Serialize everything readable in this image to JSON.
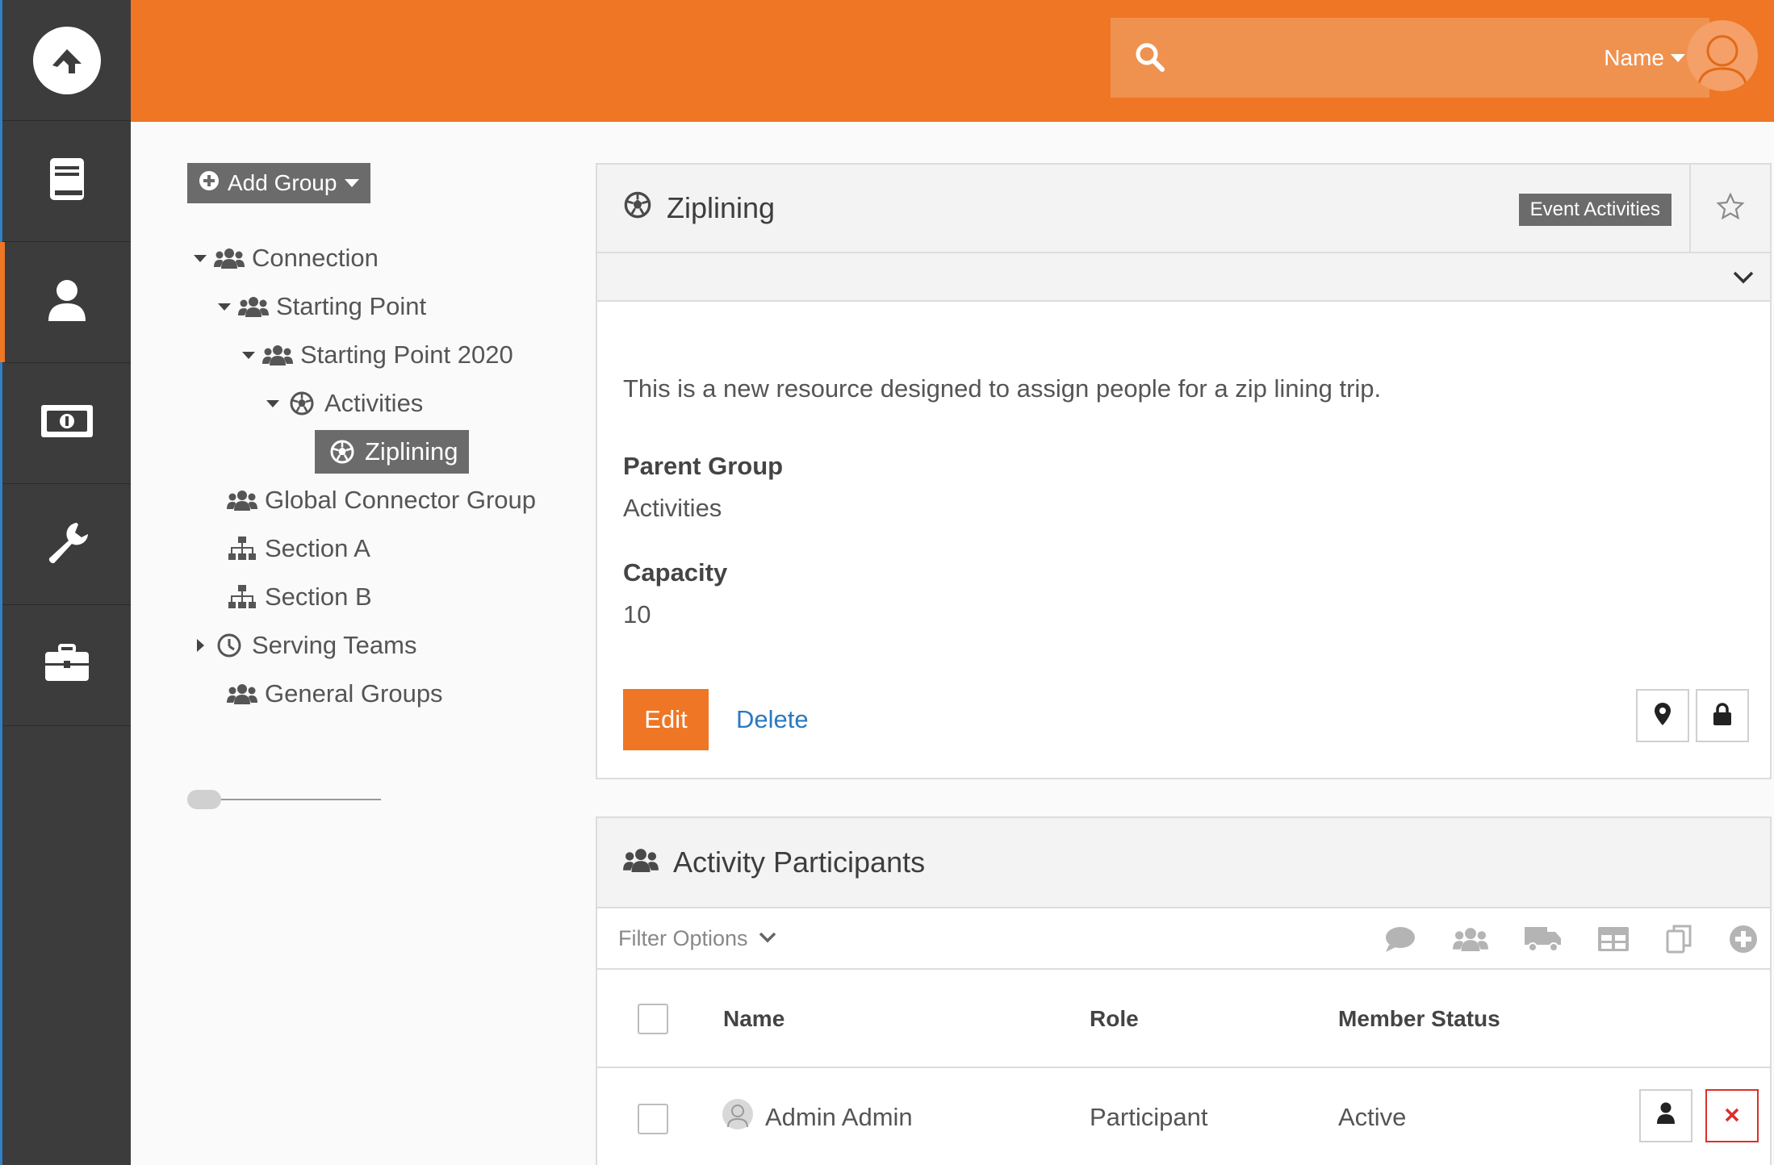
{
  "header": {
    "search": {
      "placeholder": "",
      "filter_label": "Name"
    }
  },
  "sidebar": {
    "items": [
      {
        "name": "book-icon"
      },
      {
        "name": "person-icon",
        "active": true
      },
      {
        "name": "money-icon"
      },
      {
        "name": "wrench-icon"
      },
      {
        "name": "briefcase-icon"
      }
    ]
  },
  "tree": {
    "add_group_label": "Add Group",
    "items": [
      {
        "label": "Connection",
        "level": 0,
        "expanded": true,
        "icon": "users-icon"
      },
      {
        "label": "Starting Point",
        "level": 1,
        "expanded": true,
        "icon": "users-icon"
      },
      {
        "label": "Starting Point 2020",
        "level": 2,
        "expanded": true,
        "icon": "users-icon"
      },
      {
        "label": "Activities",
        "level": 3,
        "expanded": true,
        "icon": "ball-icon"
      },
      {
        "label": "Ziplining",
        "level": 4,
        "selected": true,
        "icon": "ball-icon"
      },
      {
        "label": "Global Connector Group",
        "level": 1,
        "icon": "users-icon"
      },
      {
        "label": "Section A",
        "level": 1,
        "icon": "sitemap-icon"
      },
      {
        "label": "Section B",
        "level": 1,
        "icon": "sitemap-icon"
      },
      {
        "label": "Serving Teams",
        "level": 0,
        "collapsed": true,
        "icon": "clock-icon"
      },
      {
        "label": "General Groups",
        "level": 1,
        "icon": "users-icon"
      }
    ]
  },
  "detail": {
    "title": "Ziplining",
    "badge": "Event Activities",
    "description": "This is a new resource designed to assign people for a zip lining trip.",
    "parent_group_label": "Parent Group",
    "parent_group_value": "Activities",
    "capacity_label": "Capacity",
    "capacity_value": "10",
    "edit_label": "Edit",
    "delete_label": "Delete"
  },
  "participants": {
    "title": "Activity Participants",
    "filter_label": "Filter Options",
    "columns": {
      "name": "Name",
      "role": "Role",
      "status": "Member Status"
    },
    "rows": [
      {
        "name": "Admin Admin",
        "role": "Participant",
        "status": "Active"
      }
    ]
  },
  "colors": {
    "brand_orange": "#ee7625",
    "sidebar": "#3c3c3c",
    "link_blue": "#2a7ac0",
    "delete_red": "#d9302c"
  }
}
